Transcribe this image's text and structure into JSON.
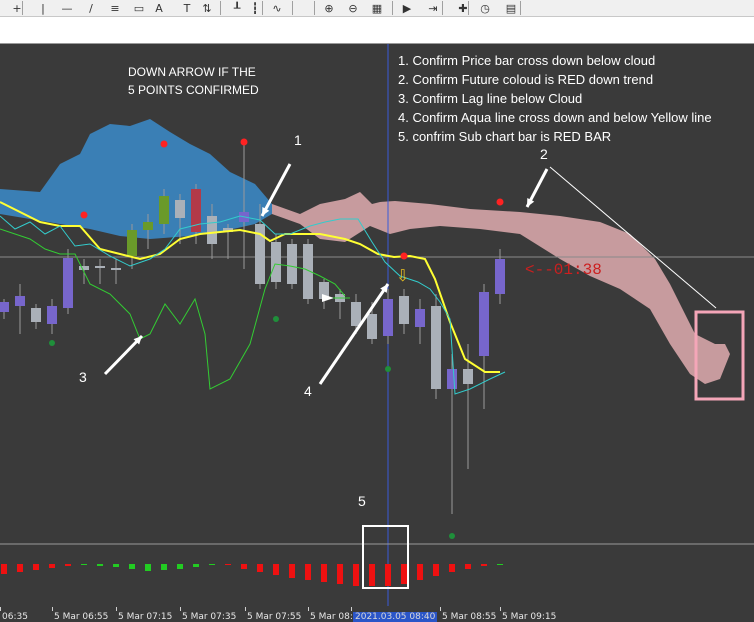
{
  "toolbar": {
    "buttons": [
      {
        "name": "crosshair-icon",
        "glyph": "+"
      },
      {
        "name": "vertical-line-icon",
        "glyph": "|"
      },
      {
        "name": "horizontal-line-icon",
        "glyph": "—"
      },
      {
        "name": "trendline-icon",
        "glyph": "/"
      },
      {
        "name": "fibonacci-icon",
        "glyph": "≡"
      },
      {
        "name": "shapes-icon",
        "glyph": "▭"
      },
      {
        "name": "text-icon",
        "glyph": "A"
      },
      {
        "name": "text-label-icon",
        "glyph": "T"
      },
      {
        "name": "arrows-dropdown-icon",
        "glyph": "⇅"
      },
      {
        "name": "bar-chart-icon",
        "glyph": "┸"
      },
      {
        "name": "candlestick-icon",
        "glyph": "┇"
      },
      {
        "name": "line-chart-icon",
        "glyph": "∿"
      },
      {
        "name": "zoom-in-icon",
        "glyph": "⊕"
      },
      {
        "name": "zoom-out-icon",
        "glyph": "⊖"
      },
      {
        "name": "tile-windows-icon",
        "glyph": "▦"
      },
      {
        "name": "auto-scroll-icon",
        "glyph": "▶"
      },
      {
        "name": "chart-shift-icon",
        "glyph": "⇥"
      },
      {
        "name": "indicators-icon",
        "glyph": "✚"
      },
      {
        "name": "periods-icon",
        "glyph": "◷"
      },
      {
        "name": "templates-icon",
        "glyph": "▤"
      }
    ]
  },
  "annotations": {
    "header_left": "DOWN ARROW  IF THE\n5 POINTS CONFIRMED",
    "rules": [
      "1. Confirm Price bar cross down below cloud",
      "2. Confirm Future coloud is RED down trend",
      "3. Confirm Lag line below Cloud",
      "4. Confirm Aqua line cross down and below Yellow line",
      "5. confrim Sub chart bar is RED BAR"
    ],
    "point_labels": [
      "1",
      "2",
      "3",
      "4",
      "5"
    ],
    "countdown": "<--01:38",
    "down_arrow": "⇩"
  },
  "time_axis": {
    "labels": [
      "06:35",
      "5 Mar 06:55",
      "5 Mar 07:15",
      "5 Mar 07:35",
      "5 Mar 07:55",
      "5 Mar 08:",
      "2021.03.05 08:40",
      "5 Mar 08:55",
      "5 Mar 09:15"
    ],
    "highlighted_label": "2021.03.05 08:40"
  },
  "colors": {
    "background": "#3a3a3a",
    "cloud_bull": "#3a7fb5",
    "cloud_bear": "#c79b9e",
    "tenkan": "#ffff33",
    "kijun": "#33cccc",
    "chikou": "#33cc33",
    "bull_candle": "#7766cc",
    "bear_candle": "#aab0b8",
    "green_candle": "#6a9a2a",
    "red_candle": "#b23a48",
    "sub_bull": "#22cc22",
    "sub_bear": "#ee1111",
    "highlight_box": "#f4a6b8",
    "current_time_line": "#3a5bd8"
  }
}
